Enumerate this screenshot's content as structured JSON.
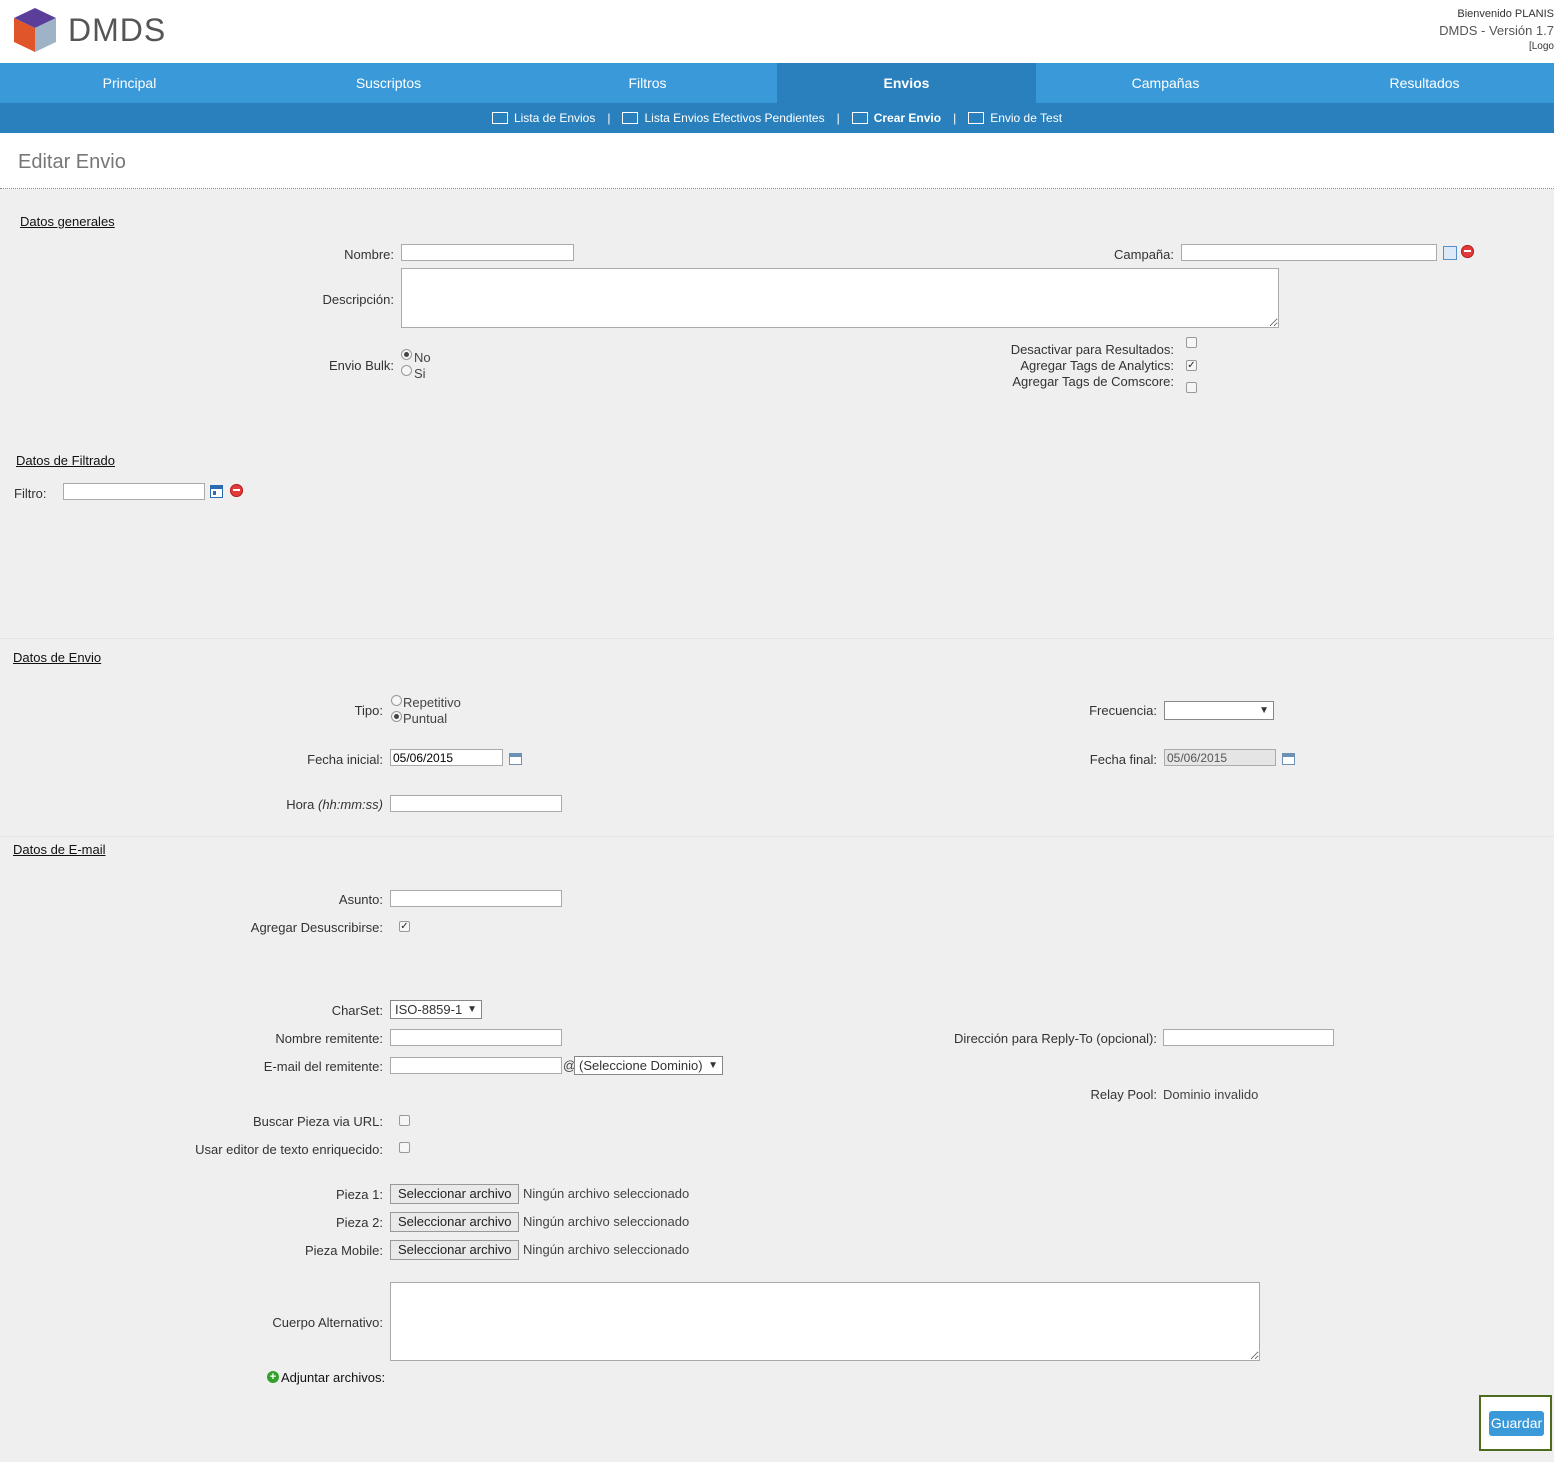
{
  "header": {
    "logo_text": "DMDS",
    "welcome": "Bienvenido PLANIS",
    "version": "DMDS - Versión 1.7",
    "logout": "[Logo"
  },
  "nav": {
    "tabs": [
      {
        "label": "Principal"
      },
      {
        "label": "Suscriptos"
      },
      {
        "label": "Filtros"
      },
      {
        "label": "Envios",
        "active": true
      },
      {
        "label": "Campañas"
      },
      {
        "label": "Resultados"
      }
    ],
    "sub": {
      "lista_envios": "Lista de Envios",
      "lista_pendientes": "Lista Envios Efectivos Pendientes",
      "crear_envio": "Crear Envio",
      "envio_test": "Envio de Test",
      "separator": "|"
    }
  },
  "page": {
    "title": "Editar Envio"
  },
  "generales": {
    "section": "Datos generales",
    "nombre_label": "Nombre:",
    "nombre_value": "",
    "campana_label": "Campaña:",
    "campana_value": "",
    "descripcion_label": "Descripción:",
    "descripcion_value": "",
    "bulk_label": "Envio Bulk:",
    "bulk_no": "No",
    "bulk_si": "Si",
    "desactivar_label": "Desactivar para Resultados:",
    "analytics_label": "Agregar Tags de Analytics:",
    "comscore_label": "Agregar Tags de Comscore:",
    "check_mark": "✓"
  },
  "filtrado": {
    "section": "Datos de Filtrado",
    "filtro_label": "Filtro:",
    "filtro_value": ""
  },
  "envio": {
    "section": "Datos de Envio",
    "tipo_label": "Tipo:",
    "tipo_repetitivo": "Repetitivo",
    "tipo_puntual": "Puntual",
    "frecuencia_label": "Frecuencia:",
    "frecuencia_value": "",
    "fecha_inicial_label": "Fecha inicial:",
    "fecha_inicial_value": "05/06/2015",
    "fecha_final_label": "Fecha final:",
    "fecha_final_value": "05/06/2015",
    "hora_label": "Hora",
    "hora_hint": "(hh:mm:ss)",
    "hora_value": ""
  },
  "email": {
    "section": "Datos de E-mail",
    "asunto_label": "Asunto:",
    "asunto_value": "",
    "desuscribirse_label": "Agregar Desuscribirse:",
    "charset_label": "CharSet:",
    "charset_value": "ISO-8859-1",
    "remitente_label": "Nombre remitente:",
    "remitente_value": "",
    "replyto_label": "Dirección para Reply-To (opcional):",
    "replyto_value": "",
    "email_remitente_label": "E-mail del remitente:",
    "email_remitente_value": "",
    "at": "@",
    "dominio_value": "(Seleccione Dominio)",
    "relay_label": "Relay Pool:",
    "relay_value": "Dominio invalido",
    "buscar_label": "Buscar Pieza via URL:",
    "editor_label": "Usar editor de texto enriquecido:",
    "pieza1_label": "Pieza 1:",
    "pieza2_label": "Pieza 2:",
    "pieza_mobile_label": "Pieza Mobile:",
    "file_button": "Seleccionar archivo",
    "file_none": "Ningún archivo seleccionado",
    "cuerpo_label": "Cuerpo Alternativo:",
    "cuerpo_value": "",
    "adjuntar_label": "Adjuntar archivos:"
  },
  "actions": {
    "guardar": "Guardar"
  },
  "colors": {
    "nav": "#3a99d9",
    "nav_active": "#2a80bd",
    "background": "#efefef"
  },
  "icons": [
    "logo-cube-icon",
    "envelope-icon",
    "printer-icon",
    "envelope-plus-icon",
    "envelope-check-icon",
    "list-icon",
    "delete-icon",
    "window-icon",
    "calendar-icon",
    "add-icon"
  ]
}
